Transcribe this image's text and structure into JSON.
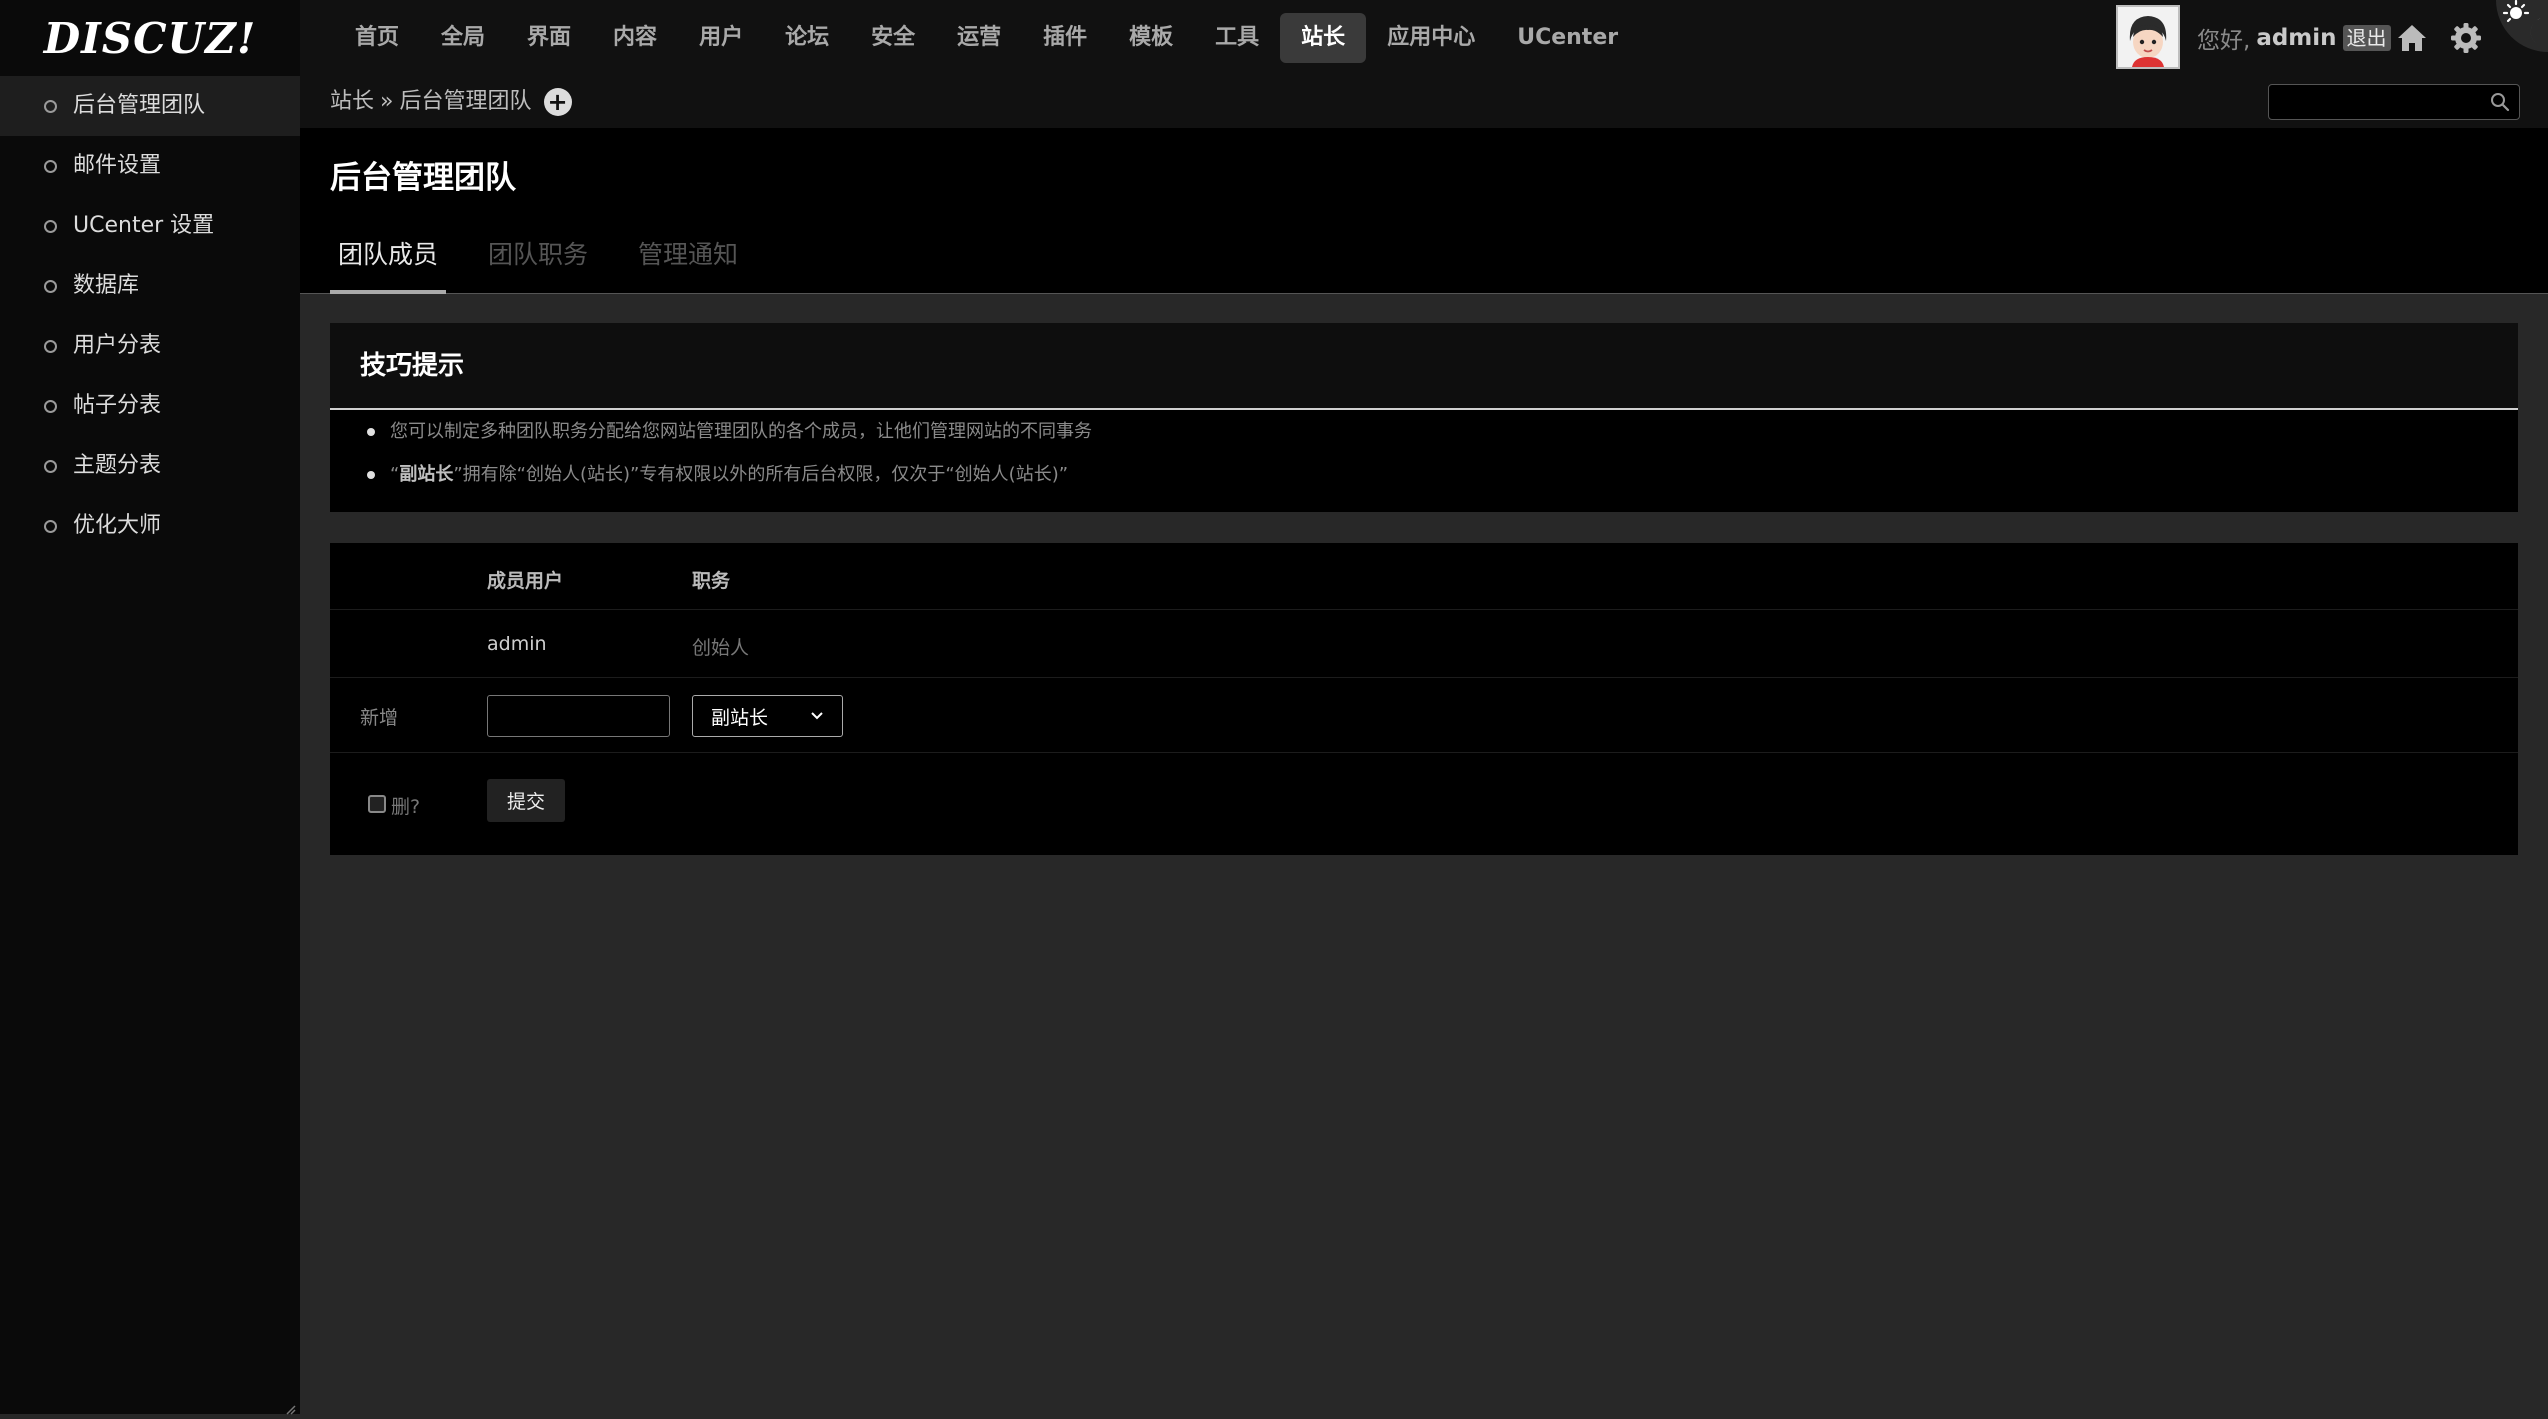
{
  "header": {
    "logo_text": "DISCUZ!",
    "nav": [
      "首页",
      "全局",
      "界面",
      "内容",
      "用户",
      "论坛",
      "安全",
      "运营",
      "插件",
      "模板",
      "工具",
      "站长",
      "应用中心",
      "UCenter"
    ],
    "active_nav": "站长",
    "greeting_prefix": "您好,",
    "username": "admin",
    "logout_label": "退出",
    "icons": [
      "avatar",
      "home-icon",
      "settings-gear-icon",
      "theme-toggle-icon"
    ]
  },
  "sidebar": {
    "items": [
      "后台管理团队",
      "邮件设置",
      "UCenter 设置",
      "数据库",
      "用户分表",
      "帖子分表",
      "主题分表",
      "优化大师"
    ],
    "active_item": "后台管理团队"
  },
  "breadcrumb": {
    "parent": "站长",
    "separator": "»",
    "current": "后台管理团队",
    "add_label": "+"
  },
  "search": {
    "placeholder": "",
    "value": ""
  },
  "page": {
    "title": "后台管理团队",
    "tabs": [
      "团队成员",
      "团队职务",
      "管理通知"
    ],
    "active_tab": "团队成员"
  },
  "tips": {
    "title": "技巧提示",
    "items": [
      {
        "bold": "",
        "text": "您可以制定多种团队职务分配给您网站管理团队的各个成员，让他们管理网站的不同事务"
      },
      {
        "prefix": "“",
        "bold": "副站长",
        "text": "”拥有除“创始人(站长)”专有权限以外的所有后台权限，仅次于“创始人(站长)”"
      }
    ]
  },
  "team_table": {
    "headers": {
      "member": "成员用户",
      "role": "职务"
    },
    "rows": [
      {
        "member": "admin",
        "role": "创始人"
      }
    ],
    "add_row": {
      "label": "新增",
      "input_value": "",
      "role_selected": "副站长"
    },
    "delete_label": "删?",
    "submit_label": "提交"
  }
}
